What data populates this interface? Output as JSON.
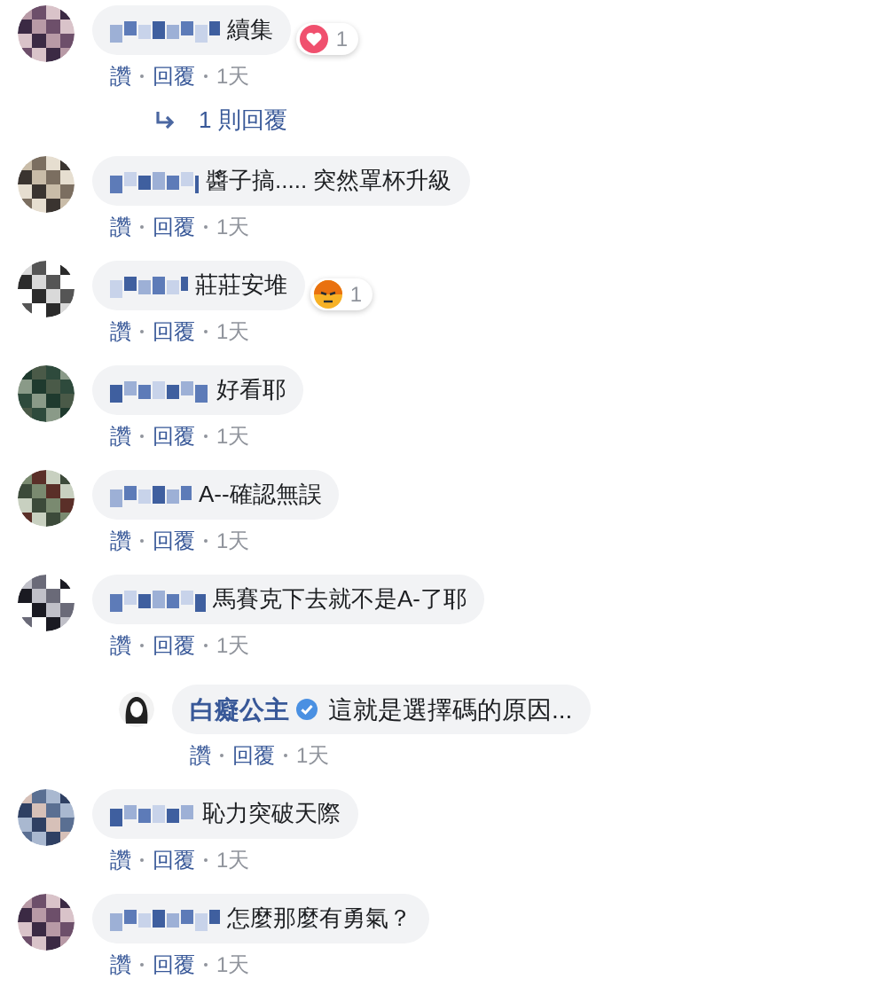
{
  "comments": [
    {
      "kind": "comment",
      "text": "續集",
      "reaction": {
        "kind": "love",
        "count": "1"
      },
      "actions": [
        "讚",
        "回覆",
        "1天"
      ]
    },
    {
      "kind": "reply-count",
      "text": "1 則回覆"
    },
    {
      "kind": "comment",
      "text": "醬子搞..... 突然罩杯升級",
      "actions": [
        "讚",
        "回覆",
        "1天"
      ]
    },
    {
      "kind": "comment",
      "text": "莊莊安堆",
      "reaction": {
        "kind": "angry",
        "count": "1"
      },
      "actions": [
        "讚",
        "回覆",
        "1天"
      ]
    },
    {
      "kind": "comment",
      "text": "好看耶",
      "actions": [
        "讚",
        "回覆",
        "1天"
      ]
    },
    {
      "kind": "comment",
      "text": "A--確認無誤",
      "actions": [
        "讚",
        "回覆",
        "1天"
      ]
    },
    {
      "kind": "comment",
      "text": "馬賽克下去就不是A-了耶",
      "actions": [
        "讚",
        "回覆",
        "1天"
      ]
    },
    {
      "kind": "reply",
      "author": "白癡公主",
      "verified": true,
      "text": "這就是選擇碼的原因...",
      "actions": [
        "讚",
        "回覆",
        "1天"
      ]
    },
    {
      "kind": "comment",
      "text": "恥力突破天際",
      "actions": [
        "讚",
        "回覆",
        "1天"
      ]
    },
    {
      "kind": "comment",
      "text": "怎麼那麼有勇氣？",
      "actions": [
        "讚",
        "回覆",
        "1天"
      ]
    }
  ]
}
